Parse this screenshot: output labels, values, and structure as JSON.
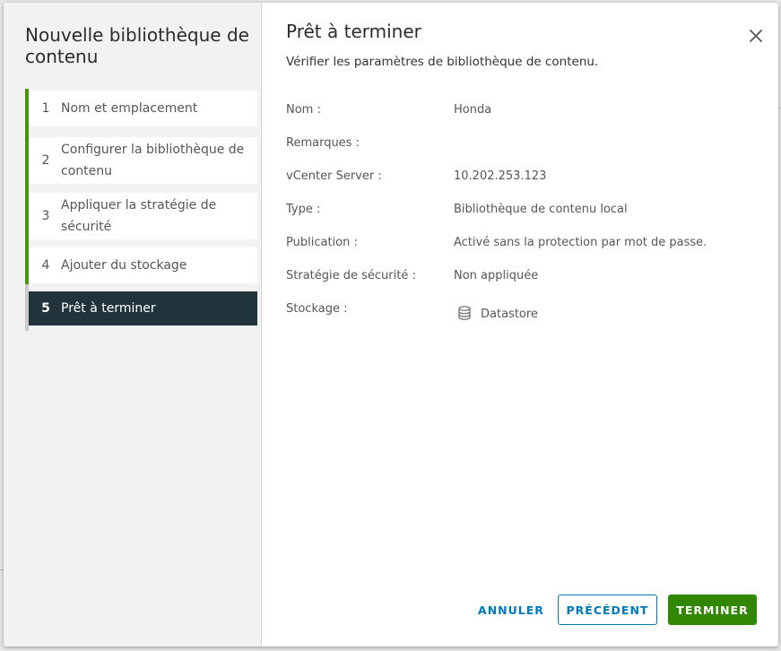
{
  "wizard": {
    "title": "Nouvelle bibliothèque de contenu",
    "steps": [
      {
        "num": "1",
        "label": "Nom et emplacement"
      },
      {
        "num": "2",
        "label": "Configurer la bibliothèque de contenu"
      },
      {
        "num": "3",
        "label": "Appliquer la stratégie de sécurité"
      },
      {
        "num": "4",
        "label": "Ajouter du stockage"
      },
      {
        "num": "5",
        "label": "Prêt à terminer"
      }
    ],
    "active_step": 5
  },
  "page": {
    "title": "Prêt à terminer",
    "subtitle": "Vérifier les paramètres de bibliothèque de contenu."
  },
  "summary": {
    "name_label": "Nom :",
    "name_value": "Honda",
    "notes_label": "Remarques :",
    "notes_value": "",
    "vcenter_label": "vCenter Server :",
    "vcenter_value": "10.202.253.123",
    "type_label": "Type :",
    "type_value": "Bibliothèque de contenu local",
    "publication_label": "Publication :",
    "publication_value": "Activé sans la protection par mot de passe.",
    "security_label": "Stratégie de sécurité :",
    "security_value": "Non appliquée",
    "storage_label": "Stockage :",
    "storage_value": "Datastore",
    "storage_icon": "database-icon"
  },
  "footer": {
    "cancel_label": "ANNULER",
    "previous_label": "PRÉCÉDENT",
    "finish_label": "TERMINER"
  },
  "colors": {
    "primary": "#0079b8",
    "success": "#318700",
    "active_step": "#21333b",
    "step_done": "#48960c"
  }
}
